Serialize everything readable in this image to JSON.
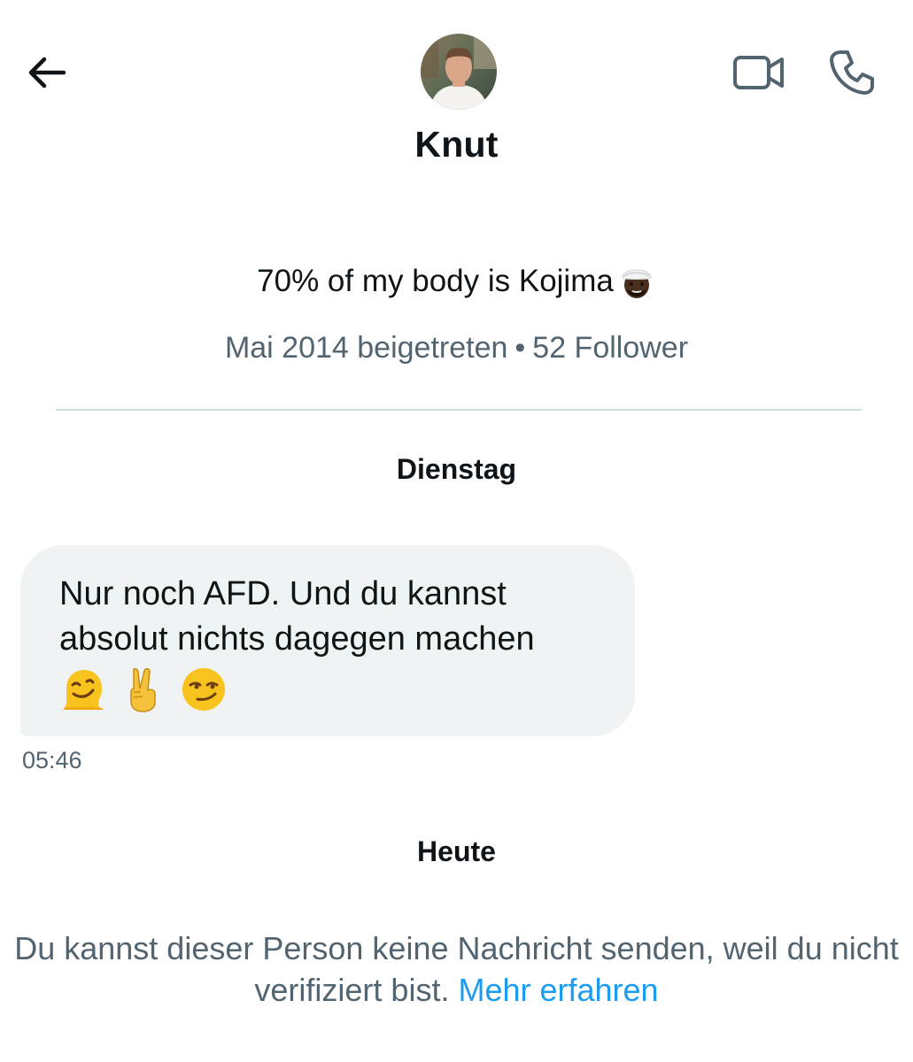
{
  "header": {
    "back_icon": "arrow-left-icon",
    "video_icon": "video-camera-icon",
    "phone_icon": "phone-icon"
  },
  "profile": {
    "name": "Knut",
    "bio": "70% of my body is Kojima",
    "bio_emoji": "man-with-turban-dark-skin-emoji",
    "joined": "Mai 2014 beigetreten",
    "separator": "•",
    "followers": "52 Follower"
  },
  "conversation": {
    "day_1": "Dienstag",
    "message": {
      "text": "Nur noch AFD. Und du kannst absolut nichts dagegen machen",
      "emojis": [
        "melting-face-emoji",
        "victory-hand-emoji",
        "smirking-face-emoji"
      ],
      "time": "05:46"
    },
    "day_2": "Heute"
  },
  "footer": {
    "notice": "Du kannst dieser Person keine Nachricht senden, weil du nicht verifiziert bist.",
    "link": "Mehr erfahren"
  },
  "colors": {
    "text": "#0f1419",
    "secondary": "#536471",
    "bubble": "#eff3f4",
    "link": "#1d9bf0",
    "divider": "#cfd9de"
  }
}
